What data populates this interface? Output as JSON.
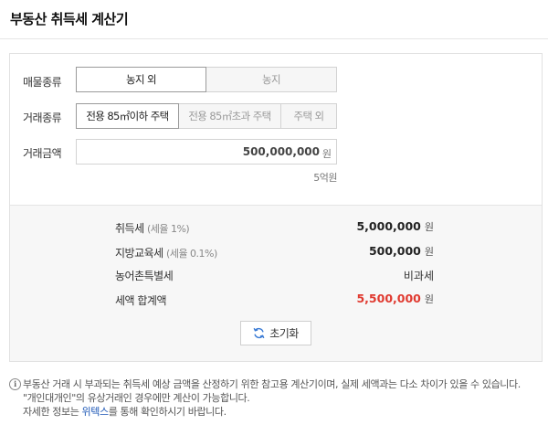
{
  "title": "부동산 취득세 계산기",
  "form": {
    "property_type_label": "매물종류",
    "property_types": [
      "농지 외",
      "농지"
    ],
    "deal_type_label": "거래종류",
    "deal_types": [
      "전용 85㎡이하 주택",
      "전용 85㎡초과 주택",
      "주택 외"
    ],
    "amount_label": "거래금액",
    "amount_value": "500,000,000",
    "amount_unit": "원",
    "amount_korean": "5억원"
  },
  "results": {
    "acquisition_tax_label": "취득세",
    "acquisition_tax_rate": "(세율 1%)",
    "acquisition_tax_value": "5,000,000",
    "education_tax_label": "지방교육세",
    "education_tax_rate": "(세율 0.1%)",
    "education_tax_value": "500,000",
    "rural_tax_label": "농어촌특별세",
    "rural_tax_value": "비과세",
    "total_label": "세액 합계액",
    "total_value": "5,500,000",
    "unit": "원"
  },
  "reset_label": "초기화",
  "notice": {
    "line1": "부동산 거래 시 부과되는 취득세 예상 금액을 산정하기 위한 참고용 계산기이며, 실제 세액과는 다소 차이가 있을 수 있습니다.",
    "line2": "\"개인대개인\"의 유상거래인 경우에만 계산이 가능합니다.",
    "line3_pre": "자세한 정보는 ",
    "line3_link": "위텍스",
    "line3_post": "를 통해 확인하시기 바랍니다."
  },
  "colors": {
    "accent_red": "#e03a30",
    "link_blue": "#1a55b5",
    "reset_icon_blue": "#3a7bd5"
  }
}
